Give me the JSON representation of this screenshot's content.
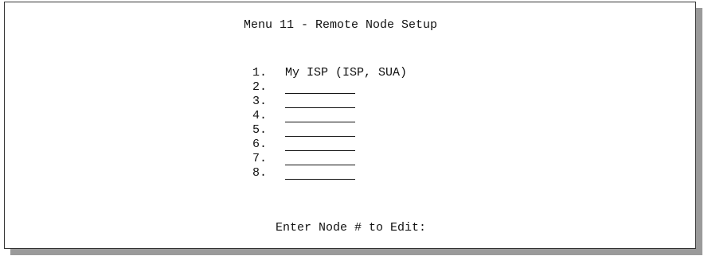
{
  "title": "Menu 11 - Remote Node Setup",
  "nodes": [
    {
      "number": "1.",
      "name": "My ISP (ISP, SUA)"
    },
    {
      "number": "2.",
      "name": ""
    },
    {
      "number": "3.",
      "name": ""
    },
    {
      "number": "4.",
      "name": ""
    },
    {
      "number": "5.",
      "name": ""
    },
    {
      "number": "6.",
      "name": ""
    },
    {
      "number": "7.",
      "name": ""
    },
    {
      "number": "8.",
      "name": ""
    }
  ],
  "prompt": "Enter Node # to Edit:"
}
